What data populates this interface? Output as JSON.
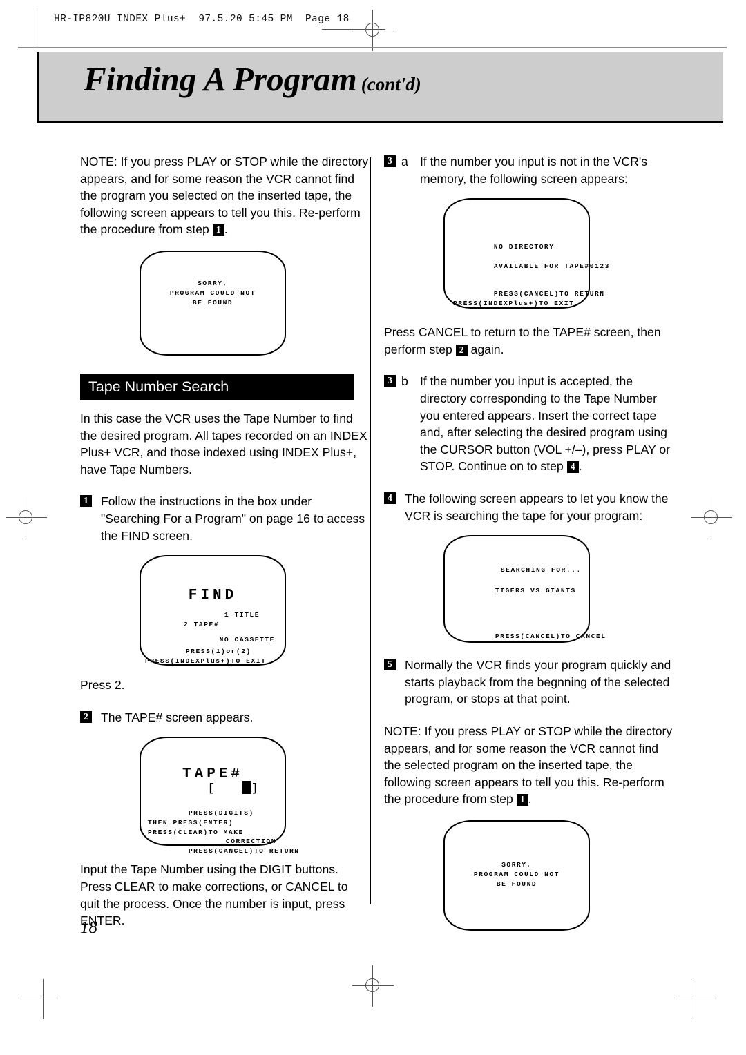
{
  "header": {
    "slug": "HR-IP820U INDEX Plus+  97.5.20 5:45 PM  Page 18"
  },
  "title": {
    "main": "Finding A Program",
    "contd": "(cont'd)"
  },
  "folio": "18",
  "left_column": {
    "note_top": "NOTE: If you press PLAY or STOP while the directory appears, and for some reason the VCR cannot find the program you selected on the inserted tape, the following screen appears to tell you this. Re-perform the procedure from step",
    "note_top_step": "1",
    "note_top_tail": ".",
    "screen_sorry": {
      "line1": "SORRY,",
      "line2": "PROGRAM COULD NOT",
      "line3": "BE FOUND"
    },
    "section_heading": "Tape Number Search",
    "section_intro": "In this case the VCR uses the Tape Number to find the desired program. All tapes recorded on an INDEX Plus+ VCR, and those indexed using INDEX Plus+, have Tape Numbers.",
    "step1_num": "1",
    "step1_text": "Follow the instructions in the box under \"Searching For a Program\" on page 16 to access the FIND screen.",
    "screen_find": {
      "title": "FIND",
      "opt1": "1 TITLE",
      "opt2": "2 TAPE#",
      "no_cassette": "NO CASSETTE",
      "press_1or2": "PRESS(1)or(2)",
      "press_exit": "PRESS(INDEXPlus+)TO EXIT"
    },
    "press_2": "Press 2.",
    "step2_num": "2",
    "step2_text": "The TAPE# screen appears.",
    "screen_tape": {
      "title": "TAPE#",
      "bracket_open": "[",
      "bracket_close": "]",
      "line1": "PRESS(DIGITS)",
      "line2": "THEN PRESS(ENTER)",
      "line3": "PRESS(CLEAR)TO MAKE",
      "line4": "CORRECTION",
      "line5": "PRESS(CANCEL)TO RETURN"
    },
    "closing_para": "Input the Tape Number using the DIGIT buttons. Press CLEAR to make corrections, or CANCEL to quit the process. Once the number is input, press ENTER."
  },
  "right_column": {
    "step3a_num": "3",
    "step3a_letter": "a",
    "step3a_text": "If the number you input is not in the VCR's memory, the following screen appears:",
    "screen_no_directory": {
      "line1": "NO DIRECTORY",
      "line2": "AVAILABLE FOR TAPE#0123",
      "line3": "PRESS(CANCEL)TO RETURN",
      "line4": "PRESS(INDEXPlus+)TO EXIT"
    },
    "after_no_directory_a": "Press CANCEL to return to the TAPE# screen, then perform step",
    "after_no_directory_step": "2",
    "after_no_directory_b": "again.",
    "step3b_num": "3",
    "step3b_letter": "b",
    "step3b_text": "If the number you input is accepted, the directory corresponding to the Tape Number you entered appears. Insert the correct tape and, after selecting the desired program using the CURSOR button (VOL +/–), press PLAY or STOP. Continue on to step",
    "step3b_step_ref": "4",
    "step3b_tail": ".",
    "step4_num": "4",
    "step4_text": "The following screen appears to let you know the VCR is searching the tape for your program:",
    "screen_searching": {
      "line1": "SEARCHING FOR...",
      "line2": "TIGERS VS GIANTS",
      "line3": "PRESS(CANCEL)TO CANCEL"
    },
    "step5_num": "5",
    "step5_text": "Normally the VCR finds your program quickly and starts playback from the begnning of the selected program, or stops at that point.",
    "note_bottom": "NOTE: If you press PLAY or STOP while the directory appears, and for some reason the VCR cannot find the selected program on the inserted tape, the following screen appears to tell you this. Re-perform the procedure from step",
    "note_bottom_step": "1",
    "note_bottom_tail": ".",
    "screen_sorry2": {
      "line1": "SORRY,",
      "line2": "PROGRAM COULD NOT",
      "line3": "BE FOUND"
    }
  }
}
